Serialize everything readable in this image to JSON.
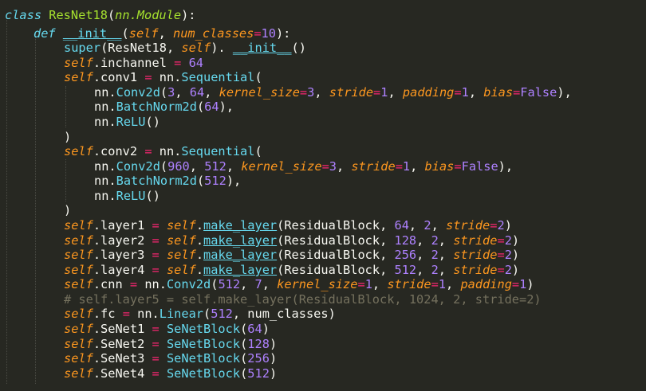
{
  "code_lines": [
    [
      [
        "kw",
        "class "
      ],
      [
        "cls",
        "ResNet18"
      ],
      [
        "punct",
        "("
      ],
      [
        "base",
        "nn.Module"
      ],
      [
        "punct",
        "):"
      ]
    ],
    [
      [
        "kw",
        "def "
      ],
      [
        "fn_u",
        "__init__"
      ],
      [
        "punct",
        "("
      ],
      [
        "self",
        "self"
      ],
      [
        "punct",
        ", "
      ],
      [
        "param",
        "num_classes"
      ],
      [
        "op",
        "="
      ],
      [
        "num",
        "10"
      ],
      [
        "punct",
        "):"
      ]
    ],
    [
      [
        "call",
        "super"
      ],
      [
        "punct",
        "(ResNet18, "
      ],
      [
        "self",
        "self"
      ],
      [
        "punct",
        "). "
      ],
      [
        "fn_u",
        "__init__"
      ],
      [
        "punct",
        "()"
      ]
    ],
    [
      [
        "self",
        "self"
      ],
      [
        "name",
        ".inchannel "
      ],
      [
        "op",
        "="
      ],
      [
        "num",
        " 64"
      ]
    ],
    [
      [
        "self",
        "self"
      ],
      [
        "name",
        ".conv1 "
      ],
      [
        "op",
        "="
      ],
      [
        "name",
        " nn."
      ],
      [
        "call",
        "Sequential"
      ],
      [
        "punct",
        "("
      ]
    ],
    [
      [
        "name",
        "nn."
      ],
      [
        "call",
        "Conv2d"
      ],
      [
        "punct",
        "("
      ],
      [
        "num",
        "3"
      ],
      [
        "punct",
        ", "
      ],
      [
        "num",
        "64"
      ],
      [
        "punct",
        ", "
      ],
      [
        "kwarg",
        "kernel_size"
      ],
      [
        "op",
        "="
      ],
      [
        "num",
        "3"
      ],
      [
        "punct",
        ", "
      ],
      [
        "kwarg",
        "stride"
      ],
      [
        "op",
        "="
      ],
      [
        "num",
        "1"
      ],
      [
        "punct",
        ", "
      ],
      [
        "kwarg",
        "padding"
      ],
      [
        "op",
        "="
      ],
      [
        "num",
        "1"
      ],
      [
        "punct",
        ", "
      ],
      [
        "kwarg",
        "bias"
      ],
      [
        "op",
        "="
      ],
      [
        "const",
        "False"
      ],
      [
        "punct",
        "),"
      ]
    ],
    [
      [
        "name",
        "nn."
      ],
      [
        "call",
        "BatchNorm2d"
      ],
      [
        "punct",
        "("
      ],
      [
        "num",
        "64"
      ],
      [
        "punct",
        "),"
      ]
    ],
    [
      [
        "name",
        "nn."
      ],
      [
        "call",
        "ReLU"
      ],
      [
        "punct",
        "()"
      ]
    ],
    [
      [
        "punct",
        ")"
      ]
    ],
    [
      [
        "self",
        "self"
      ],
      [
        "name",
        ".conv2 "
      ],
      [
        "op",
        "="
      ],
      [
        "name",
        " nn."
      ],
      [
        "call",
        "Sequential"
      ],
      [
        "punct",
        "("
      ]
    ],
    [
      [
        "name",
        "nn."
      ],
      [
        "call",
        "Conv2d"
      ],
      [
        "punct",
        "("
      ],
      [
        "num",
        "960"
      ],
      [
        "punct",
        ", "
      ],
      [
        "num",
        "512"
      ],
      [
        "punct",
        ", "
      ],
      [
        "kwarg",
        "kernel_size"
      ],
      [
        "op",
        "="
      ],
      [
        "num",
        "3"
      ],
      [
        "punct",
        ", "
      ],
      [
        "kwarg",
        "stride"
      ],
      [
        "op",
        "="
      ],
      [
        "num",
        "1"
      ],
      [
        "punct",
        ", "
      ],
      [
        "kwarg",
        "bias"
      ],
      [
        "op",
        "="
      ],
      [
        "const",
        "False"
      ],
      [
        "punct",
        "),"
      ]
    ],
    [
      [
        "name",
        "nn."
      ],
      [
        "call",
        "BatchNorm2d"
      ],
      [
        "punct",
        "("
      ],
      [
        "num",
        "512"
      ],
      [
        "punct",
        "),"
      ]
    ],
    [
      [
        "name",
        "nn."
      ],
      [
        "call",
        "ReLU"
      ],
      [
        "punct",
        "()"
      ]
    ],
    [
      [
        "punct",
        ")"
      ]
    ],
    [
      [
        "self",
        "self"
      ],
      [
        "name",
        ".layer1 "
      ],
      [
        "op",
        "="
      ],
      [
        "punct",
        " "
      ],
      [
        "self",
        "self"
      ],
      [
        "name",
        "."
      ],
      [
        "fn_u",
        "make_layer"
      ],
      [
        "punct",
        "(ResidualBlock, "
      ],
      [
        "num",
        "64"
      ],
      [
        "punct",
        ", "
      ],
      [
        "num",
        "2"
      ],
      [
        "punct",
        ", "
      ],
      [
        "kwarg",
        "stride"
      ],
      [
        "op",
        "="
      ],
      [
        "num",
        "2"
      ],
      [
        "punct",
        ")"
      ]
    ],
    [
      [
        "self",
        "self"
      ],
      [
        "name",
        ".layer2 "
      ],
      [
        "op",
        "="
      ],
      [
        "punct",
        " "
      ],
      [
        "self",
        "self"
      ],
      [
        "name",
        "."
      ],
      [
        "fn_u",
        "make_layer"
      ],
      [
        "punct",
        "(ResidualBlock, "
      ],
      [
        "num",
        "128"
      ],
      [
        "punct",
        ", "
      ],
      [
        "num",
        "2"
      ],
      [
        "punct",
        ", "
      ],
      [
        "kwarg",
        "stride"
      ],
      [
        "op",
        "="
      ],
      [
        "num",
        "2"
      ],
      [
        "punct",
        ")"
      ]
    ],
    [
      [
        "self",
        "self"
      ],
      [
        "name",
        ".layer3 "
      ],
      [
        "op",
        "="
      ],
      [
        "punct",
        " "
      ],
      [
        "self",
        "self"
      ],
      [
        "name",
        "."
      ],
      [
        "fn_u",
        "make_layer"
      ],
      [
        "punct",
        "(ResidualBlock, "
      ],
      [
        "num",
        "256"
      ],
      [
        "punct",
        ", "
      ],
      [
        "num",
        "2"
      ],
      [
        "punct",
        ", "
      ],
      [
        "kwarg",
        "stride"
      ],
      [
        "op",
        "="
      ],
      [
        "num",
        "2"
      ],
      [
        "punct",
        ")"
      ]
    ],
    [
      [
        "self",
        "self"
      ],
      [
        "name",
        ".layer4 "
      ],
      [
        "op",
        "="
      ],
      [
        "punct",
        " "
      ],
      [
        "self",
        "self"
      ],
      [
        "name",
        "."
      ],
      [
        "fn_u",
        "make_layer"
      ],
      [
        "punct",
        "(ResidualBlock, "
      ],
      [
        "num",
        "512"
      ],
      [
        "punct",
        ", "
      ],
      [
        "num",
        "2"
      ],
      [
        "punct",
        ", "
      ],
      [
        "kwarg",
        "stride"
      ],
      [
        "op",
        "="
      ],
      [
        "num",
        "2"
      ],
      [
        "punct",
        ")"
      ]
    ],
    [
      [
        "self",
        "self"
      ],
      [
        "name",
        ".cnn "
      ],
      [
        "op",
        "="
      ],
      [
        "name",
        " nn."
      ],
      [
        "call",
        "Conv2d"
      ],
      [
        "punct",
        "("
      ],
      [
        "num",
        "512"
      ],
      [
        "punct",
        ", "
      ],
      [
        "num",
        "7"
      ],
      [
        "punct",
        ", "
      ],
      [
        "kwarg",
        "kernel_size"
      ],
      [
        "op",
        "="
      ],
      [
        "num",
        "1"
      ],
      [
        "punct",
        ", "
      ],
      [
        "kwarg",
        "stride"
      ],
      [
        "op",
        "="
      ],
      [
        "num",
        "1"
      ],
      [
        "punct",
        ", "
      ],
      [
        "kwarg",
        "padding"
      ],
      [
        "op",
        "="
      ],
      [
        "num",
        "1"
      ],
      [
        "punct",
        ")"
      ]
    ],
    [
      [
        "comment",
        "# self.layer5 = self.make_layer(ResidualBlock, 1024, 2, stride=2)"
      ]
    ],
    [
      [
        "self",
        "self"
      ],
      [
        "name",
        ".fc "
      ],
      [
        "op",
        "="
      ],
      [
        "name",
        " nn."
      ],
      [
        "call",
        "Linear"
      ],
      [
        "punct",
        "("
      ],
      [
        "num",
        "512"
      ],
      [
        "punct",
        ", num_classes)"
      ]
    ],
    [
      [
        "self",
        "self"
      ],
      [
        "name",
        ".SeNet1 "
      ],
      [
        "op",
        "="
      ],
      [
        "name",
        " "
      ],
      [
        "call",
        "SeNetBlock"
      ],
      [
        "punct",
        "("
      ],
      [
        "num",
        "64"
      ],
      [
        "punct",
        ")"
      ]
    ],
    [
      [
        "self",
        "self"
      ],
      [
        "name",
        ".SeNet2 "
      ],
      [
        "op",
        "="
      ],
      [
        "name",
        " "
      ],
      [
        "call",
        "SeNetBlock"
      ],
      [
        "punct",
        "("
      ],
      [
        "num",
        "128"
      ],
      [
        "punct",
        ")"
      ]
    ],
    [
      [
        "self",
        "self"
      ],
      [
        "name",
        ".SeNet3 "
      ],
      [
        "op",
        "="
      ],
      [
        "name",
        " "
      ],
      [
        "call",
        "SeNetBlock"
      ],
      [
        "punct",
        "("
      ],
      [
        "num",
        "256"
      ],
      [
        "punct",
        ")"
      ]
    ],
    [
      [
        "self",
        "self"
      ],
      [
        "name",
        ".SeNet4 "
      ],
      [
        "op",
        "="
      ],
      [
        "name",
        " "
      ],
      [
        "call",
        "SeNetBlock"
      ],
      [
        "punct",
        "("
      ],
      [
        "num",
        "512"
      ],
      [
        "punct",
        ")"
      ]
    ]
  ]
}
